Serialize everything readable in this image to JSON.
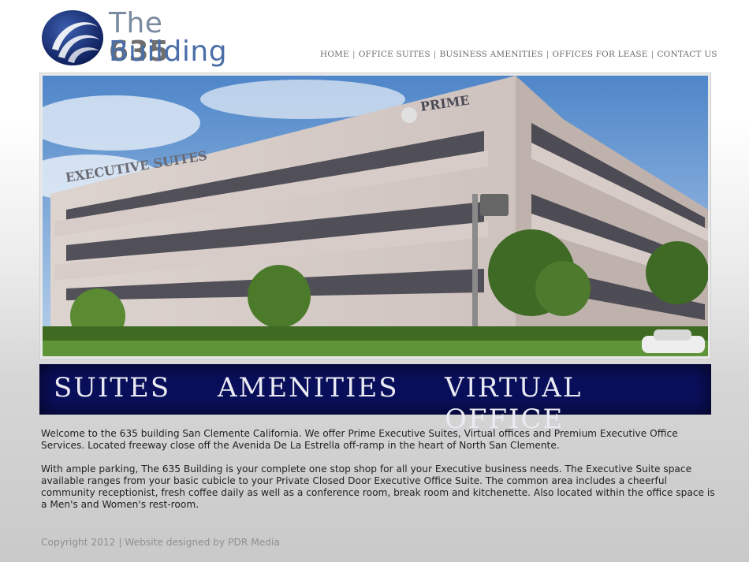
{
  "logo": {
    "word_the": "The",
    "word_number": "635",
    "word_building": "Building"
  },
  "nav": {
    "items": [
      "HOME",
      "OFFICE SUITES",
      "BUSINESS AMENITIES",
      "OFFICES FOR LEASE",
      "CONTACT US"
    ],
    "separator": "|"
  },
  "hero": {
    "sign_executive": "EXECUTIVE SUITES",
    "sign_prime": "PRIME"
  },
  "banner": {
    "suites": "SUITES",
    "amenities": "AMENITIES",
    "virtual_office": "VIRTUAL OFFICE"
  },
  "content": {
    "paragraph_1": "Welcome to the 635 building San Clemente California. We offer Prime Executive Suites, Virtual offices and Premium Executive Office Services. Located freeway close off the Avenida De La Estrella off-ramp in the heart of North San Clemente.",
    "paragraph_2": "With ample parking, The 635 Building is your complete one stop shop for all your Executive business needs. The Executive Suite space available ranges from your basic cubicle to your Private Closed Door Executive Office Suite. The common area includes a cheerful community receptionist, fresh coffee daily as well as a conference room, break room and kitchenette.  Also located within the office space is a Men's and Women's rest-room."
  },
  "footer": {
    "text": "Copyright 2012 | Website designed by PDR Media"
  },
  "colors": {
    "banner": "#0a0f5c",
    "logo_blue": "#4a6ea8",
    "nav_text": "#6a6a6a"
  }
}
